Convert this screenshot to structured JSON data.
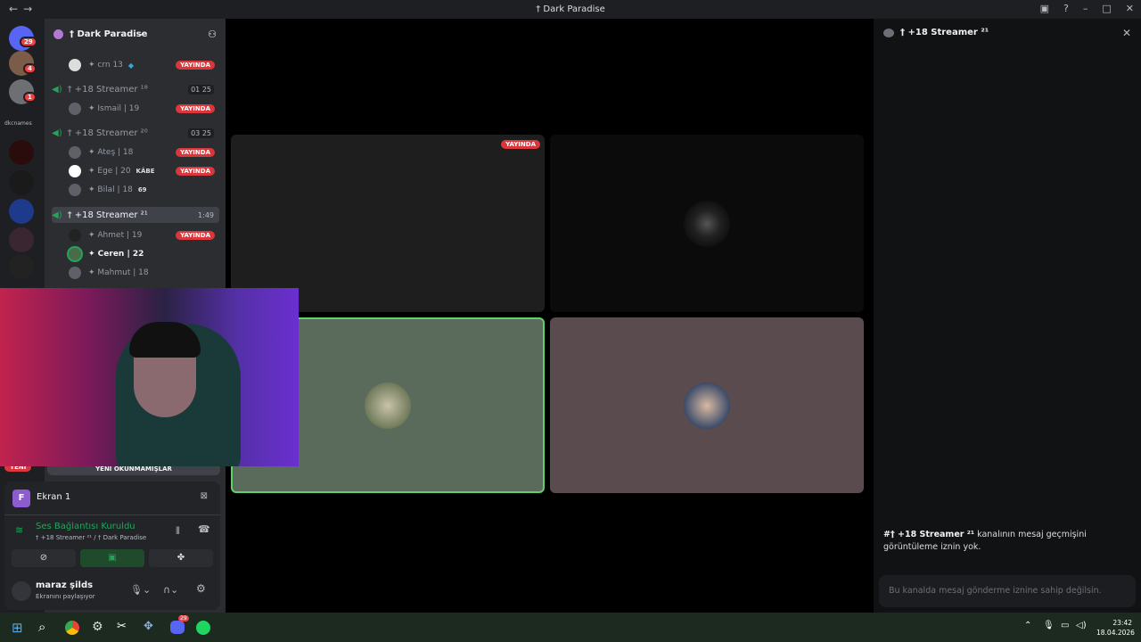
{
  "titlebar": {
    "title": "† Dark Paradise",
    "back": "←",
    "forward": "→"
  },
  "rail": {
    "home_badge": "29",
    "badges": [
      "4",
      "1"
    ],
    "label": "dkcnames"
  },
  "server": {
    "name": "† Dark Paradise"
  },
  "channels": [
    {
      "name": "† +18 Streamer ¹⁸",
      "counts": [
        "01",
        "25"
      ],
      "users": [
        {
          "name": "✦ Ismail | 19",
          "live": true
        }
      ]
    },
    {
      "name": "† +18 Streamer ²⁰",
      "counts": [
        "03",
        "25"
      ],
      "users": [
        {
          "name": "✦ Ateş | 18",
          "live": true
        },
        {
          "name": "✦ Ege | 20",
          "tag": "KÂBE",
          "live": true
        },
        {
          "name": "✦ Bilal | 18",
          "tag": "69",
          "live": false
        }
      ]
    },
    {
      "name": "† +18 Streamer ²¹",
      "time": "1:49",
      "users": [
        {
          "name": "✦ Ahmet | 19",
          "live": true
        },
        {
          "name": "✦ Ceren | 22",
          "live": false
        },
        {
          "name": "✦ Mahmut | 18",
          "live": false
        }
      ]
    }
  ],
  "top_user": {
    "name": "✦ crn 13",
    "live": true
  },
  "live_label": "YAYINDA",
  "new_label": "YENİ",
  "unread_label": "YENİ OKUNMAMIŞLAR",
  "screen": {
    "letter": "F",
    "name": "Ekran 1"
  },
  "voice": {
    "status": "Ses Bağlantısı Kuruldu",
    "path": "† +18 Streamer ²¹ / † Dark Paradise"
  },
  "me": {
    "name": "maraz şilds",
    "status": "Ekranını paylaşıyor"
  },
  "sidebar": {
    "title": "† +18 Streamer ²¹",
    "notice_bold": "#† +18 Streamer ²¹",
    "notice_rest": " kanalının mesaj geçmişini görüntüleme iznin yok.",
    "input_placeholder": "Bu kanalda mesaj gönderme iznine sahip değilsin."
  },
  "taskbar": {
    "time": "23:42",
    "date": "18.04.2026",
    "discord_badge": "29"
  },
  "colors": {
    "green": "#23a559",
    "live_red": "#da373c",
    "tile_green": "#5a6b5c",
    "tile_mauve": "#5a4b4e"
  }
}
